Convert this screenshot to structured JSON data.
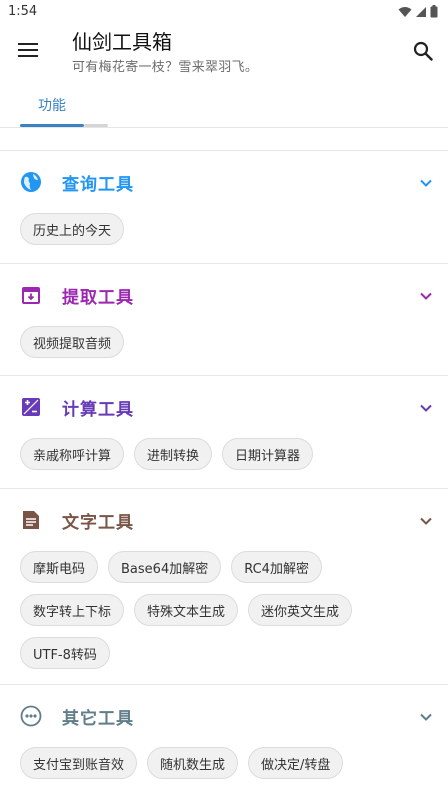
{
  "status": {
    "time": "1:54"
  },
  "app": {
    "title": "仙剑工具箱",
    "subtitle": "可有梅花寄一枝？雪来翠羽飞。"
  },
  "tabs": [
    {
      "label": "功能"
    }
  ],
  "sections": [
    {
      "title": "查询工具",
      "color": "#2196f3",
      "icon": "globe-icon",
      "chips": [
        "历史上的今天"
      ]
    },
    {
      "title": "提取工具",
      "color": "#9c27b0",
      "icon": "archive-icon",
      "chips": [
        "视频提取音频"
      ]
    },
    {
      "title": "计算工具",
      "color": "#673ab7",
      "icon": "calculator-icon",
      "chips": [
        "亲戚称呼计算",
        "进制转换",
        "日期计算器"
      ]
    },
    {
      "title": "文字工具",
      "color": "#795548",
      "icon": "document-icon",
      "chips": [
        "摩斯电码",
        "Base64加解密",
        "RC4加解密",
        "数字转上下标",
        "特殊文本生成",
        "迷你英文生成",
        "UTF-8转码"
      ]
    },
    {
      "title": "其它工具",
      "color": "#607d8b",
      "icon": "more-icon",
      "chips": [
        "支付宝到账音效",
        "随机数生成",
        "做决定/转盘"
      ]
    }
  ]
}
